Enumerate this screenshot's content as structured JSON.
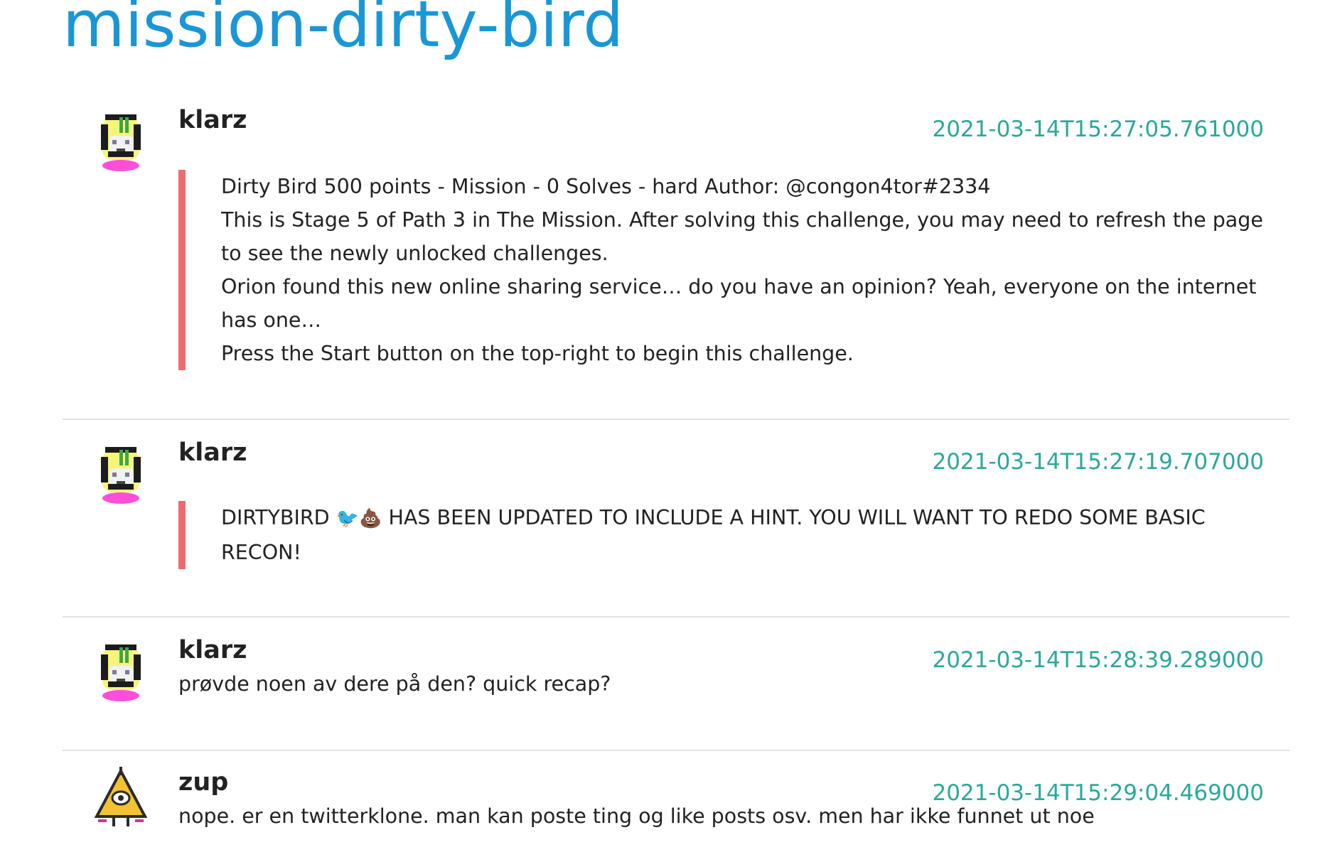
{
  "channel": {
    "title": "mission-dirty-bird"
  },
  "messages": [
    {
      "author": "klarz",
      "timestamp": "2021-03-14T15:27:05.761000",
      "avatar": "pixel-blonde-character-icon",
      "quote_lines": [
        "Dirty Bird 500 points - Mission - 0 Solves - hard Author: @congon4tor#2334",
        "This is Stage 5 of Path 3 in The Mission. After solving this challenge, you may need to refresh the page to see the newly unlocked challenges.",
        "Orion found this new online sharing service… do you have an opinion? Yeah, everyone on the internet has one…",
        "Press the Start button on the top-right to begin this challenge."
      ]
    },
    {
      "author": "klarz",
      "timestamp": "2021-03-14T15:27:19.707000",
      "avatar": "pixel-blonde-character-icon",
      "quote_prefix": "DIRTYBIRD",
      "quote_emoji_1": "🐦",
      "quote_emoji_2": "💩",
      "quote_suffix": "HAS BEEN UPDATED TO INCLUDE A HINT. YOU WILL WANT TO REDO SOME BASIC RECON!"
    },
    {
      "author": "klarz",
      "timestamp": "2021-03-14T15:28:39.289000",
      "avatar": "pixel-blonde-character-icon",
      "text": "prøvde noen av dere på den? quick recap?"
    },
    {
      "author": "zup",
      "timestamp": "2021-03-14T15:29:04.469000",
      "avatar": "triangle-character-icon",
      "text": "nope. er en twitterklone. man kan poste ting og like posts osv. men har ikke funnet ut noe"
    }
  ],
  "colors": {
    "title": "#1a96d6",
    "timestamp": "#2aa89a",
    "quote_bar": "#ee6b72",
    "divider": "#e2e2e2"
  }
}
